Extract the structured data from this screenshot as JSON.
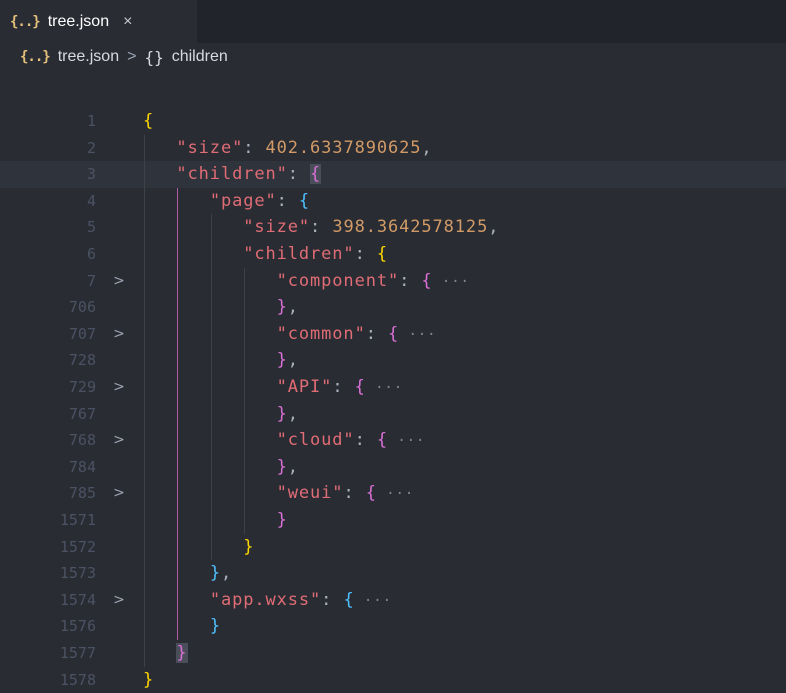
{
  "tab": {
    "icon": "{..}",
    "label": "tree.json",
    "close": "×"
  },
  "breadcrumb": {
    "icon": "{..}",
    "file": "tree.json",
    "separator": ">",
    "object_icon": "{}",
    "item": "children"
  },
  "editor": {
    "ellipsis": "···",
    "lines": [
      {
        "n": "1",
        "indent": 0,
        "fold": false,
        "tokens": [
          {
            "t": "{",
            "c": "b1"
          }
        ]
      },
      {
        "n": "2",
        "indent": 1,
        "fold": false,
        "tokens": [
          {
            "t": "\"size\"",
            "c": "key"
          },
          {
            "t": ": ",
            "c": "punc"
          },
          {
            "t": "402.6337890625",
            "c": "num"
          },
          {
            "t": ",",
            "c": "punc"
          }
        ]
      },
      {
        "n": "3",
        "indent": 1,
        "fold": false,
        "cur": true,
        "tokens": [
          {
            "t": "\"children\"",
            "c": "key"
          },
          {
            "t": ": ",
            "c": "punc"
          },
          {
            "t": "{",
            "c": "b2 hl"
          }
        ]
      },
      {
        "n": "4",
        "indent": 2,
        "fold": false,
        "tokens": [
          {
            "t": "\"page\"",
            "c": "key"
          },
          {
            "t": ": ",
            "c": "punc"
          },
          {
            "t": "{",
            "c": "b3"
          }
        ]
      },
      {
        "n": "5",
        "indent": 3,
        "fold": false,
        "tokens": [
          {
            "t": "\"size\"",
            "c": "key"
          },
          {
            "t": ": ",
            "c": "punc"
          },
          {
            "t": "398.3642578125",
            "c": "num"
          },
          {
            "t": ",",
            "c": "punc"
          }
        ]
      },
      {
        "n": "6",
        "indent": 3,
        "fold": false,
        "tokens": [
          {
            "t": "\"children\"",
            "c": "key"
          },
          {
            "t": ": ",
            "c": "punc"
          },
          {
            "t": "{",
            "c": "b1"
          }
        ]
      },
      {
        "n": "7",
        "indent": 4,
        "fold": true,
        "tokens": [
          {
            "t": "\"component\"",
            "c": "key"
          },
          {
            "t": ": ",
            "c": "punc"
          },
          {
            "t": "{",
            "c": "b2"
          },
          {
            "t": " ···",
            "c": "ell"
          }
        ]
      },
      {
        "n": "706",
        "indent": 4,
        "fold": false,
        "tokens": [
          {
            "t": "}",
            "c": "b2"
          },
          {
            "t": ",",
            "c": "punc"
          }
        ]
      },
      {
        "n": "707",
        "indent": 4,
        "fold": true,
        "tokens": [
          {
            "t": "\"common\"",
            "c": "key"
          },
          {
            "t": ": ",
            "c": "punc"
          },
          {
            "t": "{",
            "c": "b2"
          },
          {
            "t": " ···",
            "c": "ell"
          }
        ]
      },
      {
        "n": "728",
        "indent": 4,
        "fold": false,
        "tokens": [
          {
            "t": "}",
            "c": "b2"
          },
          {
            "t": ",",
            "c": "punc"
          }
        ]
      },
      {
        "n": "729",
        "indent": 4,
        "fold": true,
        "tokens": [
          {
            "t": "\"API\"",
            "c": "key"
          },
          {
            "t": ": ",
            "c": "punc"
          },
          {
            "t": "{",
            "c": "b2"
          },
          {
            "t": " ···",
            "c": "ell"
          }
        ]
      },
      {
        "n": "767",
        "indent": 4,
        "fold": false,
        "tokens": [
          {
            "t": "}",
            "c": "b2"
          },
          {
            "t": ",",
            "c": "punc"
          }
        ]
      },
      {
        "n": "768",
        "indent": 4,
        "fold": true,
        "tokens": [
          {
            "t": "\"cloud\"",
            "c": "key"
          },
          {
            "t": ": ",
            "c": "punc"
          },
          {
            "t": "{",
            "c": "b2"
          },
          {
            "t": " ···",
            "c": "ell"
          }
        ]
      },
      {
        "n": "784",
        "indent": 4,
        "fold": false,
        "tokens": [
          {
            "t": "}",
            "c": "b2"
          },
          {
            "t": ",",
            "c": "punc"
          }
        ]
      },
      {
        "n": "785",
        "indent": 4,
        "fold": true,
        "tokens": [
          {
            "t": "\"weui\"",
            "c": "key"
          },
          {
            "t": ": ",
            "c": "punc"
          },
          {
            "t": "{",
            "c": "b2"
          },
          {
            "t": " ···",
            "c": "ell"
          }
        ]
      },
      {
        "n": "1571",
        "indent": 4,
        "fold": false,
        "tokens": [
          {
            "t": "}",
            "c": "b2"
          }
        ]
      },
      {
        "n": "1572",
        "indent": 3,
        "fold": false,
        "tokens": [
          {
            "t": "}",
            "c": "b1"
          }
        ]
      },
      {
        "n": "1573",
        "indent": 2,
        "fold": false,
        "tokens": [
          {
            "t": "}",
            "c": "b3"
          },
          {
            "t": ",",
            "c": "punc"
          }
        ]
      },
      {
        "n": "1574",
        "indent": 2,
        "fold": true,
        "tokens": [
          {
            "t": "\"app.wxss\"",
            "c": "key"
          },
          {
            "t": ": ",
            "c": "punc"
          },
          {
            "t": "{",
            "c": "b3"
          },
          {
            "t": " ···",
            "c": "ell"
          }
        ]
      },
      {
        "n": "1576",
        "indent": 2,
        "fold": false,
        "tokens": [
          {
            "t": "}",
            "c": "b3"
          }
        ]
      },
      {
        "n": "1577",
        "indent": 1,
        "fold": false,
        "tokens": [
          {
            "t": "}",
            "c": "b2 hl"
          }
        ]
      },
      {
        "n": "1578",
        "indent": 0,
        "fold": false,
        "tokens": [
          {
            "t": "}",
            "c": "b1"
          }
        ]
      }
    ]
  },
  "colors": {
    "background": "#292c33",
    "key": "#e06c75",
    "number": "#d19a66",
    "bracket_gold": "#ffd700",
    "bracket_pink": "#da70d6",
    "bracket_blue": "#4fc1ff",
    "line_number": "#4b5263",
    "active_guide": "#b15aa8"
  }
}
